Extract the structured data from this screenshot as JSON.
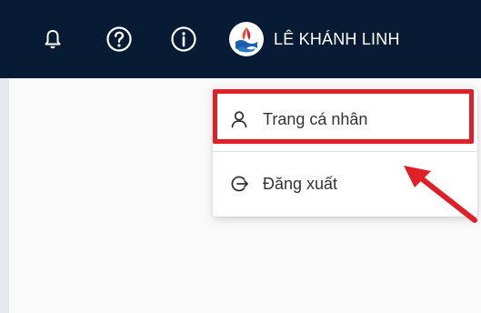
{
  "header": {
    "background": "#071b34",
    "icons": [
      "bell-icon",
      "help-icon",
      "info-icon"
    ],
    "user": {
      "name": "LÊ KHÁNH LINH",
      "avatar_icon": "company-logo-avatar"
    }
  },
  "dropdown": {
    "items": [
      {
        "label": "Trang cá nhân",
        "icon": "user-icon"
      },
      {
        "label": "Đăng xuất",
        "icon": "logout-icon"
      }
    ]
  },
  "annotation": {
    "highlight_color": "#e01f26",
    "arrow_color": "#e01f26"
  }
}
